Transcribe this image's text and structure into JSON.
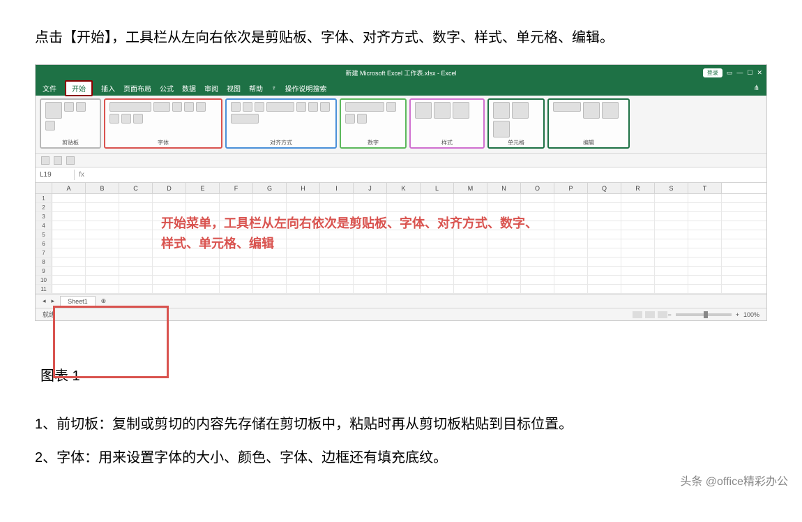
{
  "intro": "点击【开始】，工具栏从左向右依次是剪贴板、字体、对齐方式、数字、样式、单元格、编辑。",
  "excel": {
    "title_center": "新建 Microsoft Excel 工作表.xlsx - Excel",
    "title_pill": "登录",
    "menu": [
      "文件",
      "开始",
      "插入",
      "页面布局",
      "公式",
      "数据",
      "审阅",
      "视图",
      "帮助",
      "♀",
      "操作说明搜索"
    ],
    "active_menu_index": 1,
    "namebox": "L19",
    "fx": "fx",
    "groups": {
      "clipboard": "剪贴板",
      "font": "字体",
      "alignment": "对齐方式",
      "number": "数字",
      "styles": "样式",
      "cells": "单元格",
      "editing": "编辑"
    },
    "columns": [
      "A",
      "B",
      "C",
      "D",
      "E",
      "F",
      "G",
      "H",
      "I",
      "J",
      "K",
      "L",
      "M",
      "N",
      "O",
      "P",
      "Q",
      "R",
      "S",
      "T"
    ],
    "rows": [
      "1",
      "2",
      "3",
      "4",
      "5",
      "6",
      "7",
      "8",
      "9",
      "10",
      "11"
    ],
    "overlay": "开始菜单，工具栏从左向右依次是剪贴板、字体、对齐方式、数字、样式、单元格、编辑",
    "sheet_tab": "Sheet1",
    "status_left": "就绪",
    "zoom_pct": "100%"
  },
  "caption": "图表 1",
  "list": {
    "item1": "1、前切板：复制或剪切的内容先存储在剪切板中，粘贴时再从剪切板粘贴到目标位置。",
    "item2": "2、字体：用来设置字体的大小、颜色、字体、边框还有填充底纹。"
  },
  "watermark": "头条 @office精彩办公"
}
